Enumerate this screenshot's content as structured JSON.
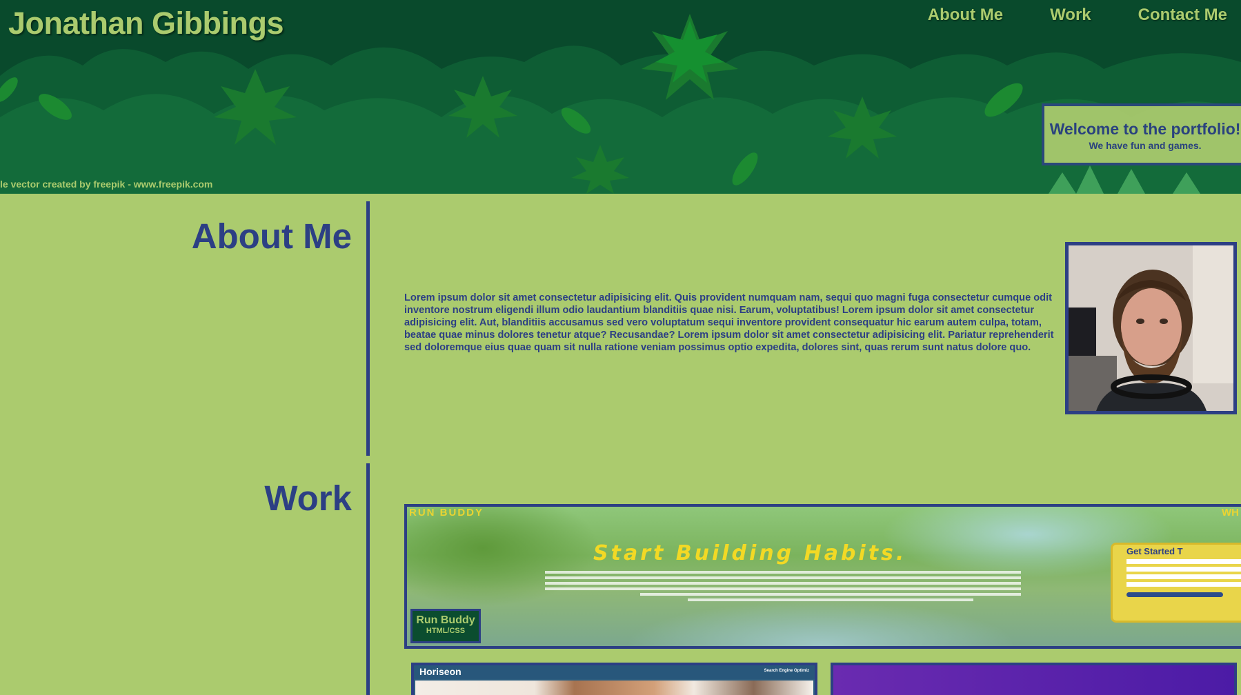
{
  "header": {
    "site_title": "Jonathan Gibbings",
    "nav": [
      "About Me",
      "Work",
      "Contact Me"
    ],
    "welcome_title": "Welcome to the portfolio!",
    "welcome_subtitle": "We have fun and games.",
    "credit": "le vector created by freepik - www.freepik.com"
  },
  "about": {
    "heading": "About Me",
    "text": "Lorem ipsum dolor sit amet consectetur adipisicing elit. Quis provident numquam nam, sequi quo magni fuga consectetur cumque odit inventore nostrum eligendi illum odio laudantium blanditiis quae nisi. Earum, voluptatibus! Lorem ipsum dolor sit amet consectetur adipisicing elit. Aut, blanditiis accusamus sed vero voluptatum sequi inventore provident consequatur hic earum autem culpa, totam, beatae quae minus dolores tenetur atque? Recusandae? Lorem ipsum dolor sit amet consectetur adipisicing elit. Pariatur reprehenderit sed doloremque eius quae quam sit nulla ratione veniam possimus optio expedita, dolores sint, quas rerum sunt natus dolore quo.",
    "portrait": "portrait-photo"
  },
  "work": {
    "heading": "Work",
    "featured": {
      "title": "Run Buddy",
      "subtitle": "HTML/CSS",
      "screenshot_brand": "RUN BUDDY",
      "screenshot_right": "WH",
      "screenshot_headline": "Start Building Habits.",
      "form_title": "Get Started T"
    },
    "projects": [
      {
        "screenshot_brand": "Horiseon",
        "screenshot_tagline": "Search Engine Optimiz"
      },
      {
        "screenshot_brand": ""
      }
    ]
  },
  "colors": {
    "background": "#abcb6e",
    "navy": "#2c3f84",
    "forest": "#0b4d2f",
    "accent_yellow": "#e9d432"
  }
}
